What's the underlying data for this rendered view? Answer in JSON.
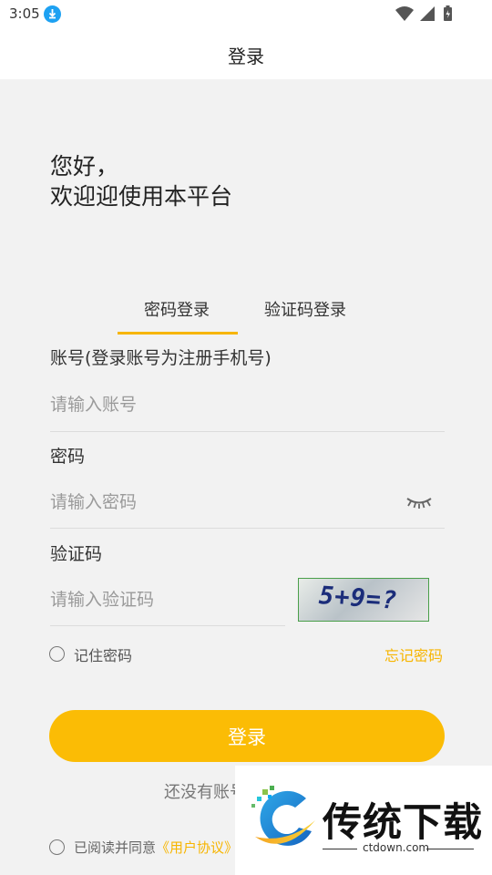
{
  "status_bar": {
    "time": "3:05"
  },
  "header": {
    "title": "登录"
  },
  "greeting": {
    "line1": "您好，",
    "line2": "欢迎迎使用本平台"
  },
  "tabs": [
    {
      "label": "密码登录",
      "active": true
    },
    {
      "label": "验证码登录",
      "active": false
    }
  ],
  "form": {
    "account_label": "账号(登录账号为注册手机号)",
    "account_placeholder": "请输入账号",
    "password_label": "密码",
    "password_placeholder": "请输入密码",
    "captcha_label": "验证码",
    "captcha_placeholder": "请输入验证码",
    "captcha_image_text": "5+9=?",
    "remember_label": "记住密码",
    "forgot_label": "忘记密码",
    "login_button": "登录",
    "register_prompt": "还没有账号",
    "agree_prefix": "已阅读并同意",
    "user_agreement": "《用户协议》"
  },
  "watermark": {
    "brand": "传统下载",
    "site": "ctdown.com"
  },
  "colors": {
    "accent": "#fbbc05",
    "link": "#f7b500",
    "background": "#f2f2f2"
  }
}
